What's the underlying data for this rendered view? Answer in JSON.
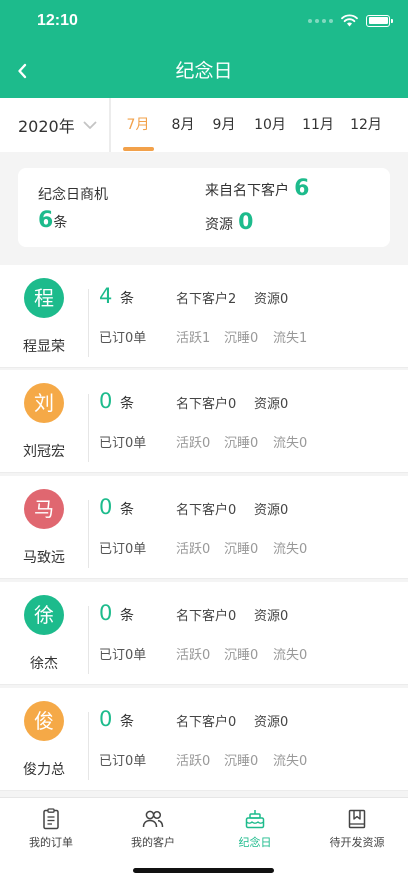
{
  "status_bar": {
    "time": "12:10"
  },
  "nav": {
    "title": "纪念日"
  },
  "filter": {
    "year": "2020年",
    "months": [
      "7月",
      "8月",
      "9月",
      "10月",
      "11月",
      "12月"
    ],
    "active_month": "7月"
  },
  "summary": {
    "opportunity_label": "纪念日商机",
    "opportunity_count": "6",
    "opportunity_unit": "条",
    "from_customer_label": "来自名下客户",
    "from_customer_count": "6",
    "resource_label": "资源",
    "resource_count": "0"
  },
  "customers": [
    {
      "avatar_char": "程",
      "avatar_color": "#1dbb8c",
      "name": "程显荣",
      "count": "4",
      "unit": "条",
      "owned": "名下客户2",
      "resource": "资源0",
      "ordered": "已订0单",
      "active": "活跃1",
      "dormant": "沉睡0",
      "lost": "流失1"
    },
    {
      "avatar_char": "刘",
      "avatar_color": "#f5a947",
      "name": "刘冠宏",
      "count": "0",
      "unit": "条",
      "owned": "名下客户0",
      "resource": "资源0",
      "ordered": "已订0单",
      "active": "活跃0",
      "dormant": "沉睡0",
      "lost": "流失0"
    },
    {
      "avatar_char": "马",
      "avatar_color": "#e06770",
      "name": "马致远",
      "count": "0",
      "unit": "条",
      "owned": "名下客户0",
      "resource": "资源0",
      "ordered": "已订0单",
      "active": "活跃0",
      "dormant": "沉睡0",
      "lost": "流失0"
    },
    {
      "avatar_char": "徐",
      "avatar_color": "#1dbb8c",
      "name": "徐杰",
      "count": "0",
      "unit": "条",
      "owned": "名下客户0",
      "resource": "资源0",
      "ordered": "已订0单",
      "active": "活跃0",
      "dormant": "沉睡0",
      "lost": "流失0"
    },
    {
      "avatar_char": "俊",
      "avatar_color": "#f5a947",
      "name": "俊力总",
      "count": "0",
      "unit": "条",
      "owned": "名下客户0",
      "resource": "资源0",
      "ordered": "已订0单",
      "active": "活跃0",
      "dormant": "沉睡0",
      "lost": "流失0"
    }
  ],
  "tabbar": {
    "items": [
      {
        "label": "我的订单",
        "icon": "clipboard-icon"
      },
      {
        "label": "我的客户",
        "icon": "users-icon"
      },
      {
        "label": "纪念日",
        "icon": "cake-icon"
      },
      {
        "label": "待开发资源",
        "icon": "bookmark-book-icon"
      }
    ],
    "active": "纪念日"
  },
  "colors": {
    "brand": "#1dbb8c",
    "accent": "#f2a14a"
  }
}
